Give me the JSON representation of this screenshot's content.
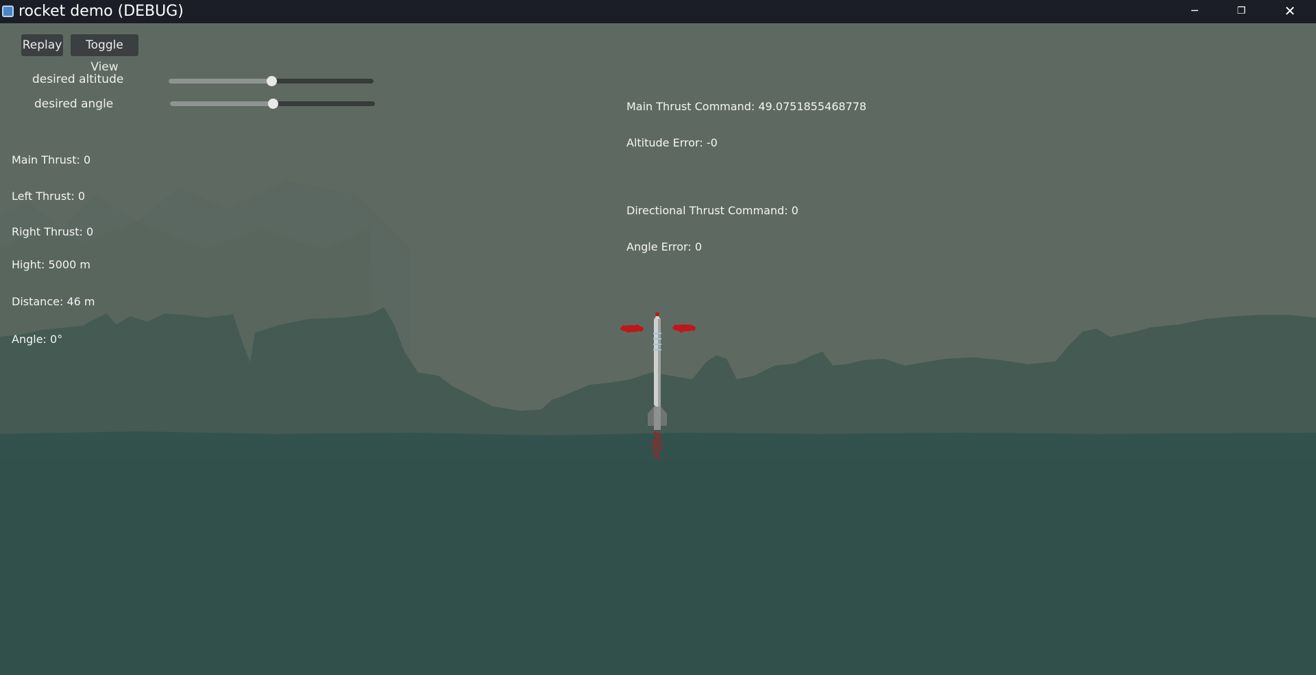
{
  "window": {
    "title": "rocket demo (DEBUG)",
    "minimize_glyph": "─",
    "maximize_glyph": "❐",
    "close_glyph": "✕"
  },
  "controls": {
    "replay_label": "Replay",
    "toggle_view_label": "Toggle View",
    "sliders": [
      {
        "label": "desired altitude",
        "value": 0.5
      },
      {
        "label": "desired angle",
        "value": 0.5
      }
    ]
  },
  "telemetry": {
    "main_thrust": {
      "label": "Main Thrust:",
      "value": "0"
    },
    "left_thrust": {
      "label": "Left Thrust:",
      "value": "0"
    },
    "right_thrust": {
      "label": "Right Thrust:",
      "value": "0"
    },
    "height": {
      "label": "Hight:",
      "value": "5000 m"
    },
    "distance": {
      "label": "Distance:",
      "value": "46 m"
    },
    "angle": {
      "label": "Angle:",
      "value": "0°"
    }
  },
  "controller": {
    "main_thrust_command": {
      "label": "Main Thrust Command:",
      "value": "49.0751855468778"
    },
    "altitude_error": {
      "label": "Altitude Error:",
      "value": "-0"
    },
    "directional_thrust_command": {
      "label": "Directional Thrust Command:",
      "value": "0"
    },
    "angle_error": {
      "label": "Angle Error:",
      "value": "0"
    }
  },
  "colors": {
    "sky": "#5e6a61",
    "far_mountains": "#56645b",
    "mid_mountains": "#445a53",
    "ground": "#31504b",
    "exhaust": "#c0161a",
    "rocket_body": "#d7d9d8"
  }
}
